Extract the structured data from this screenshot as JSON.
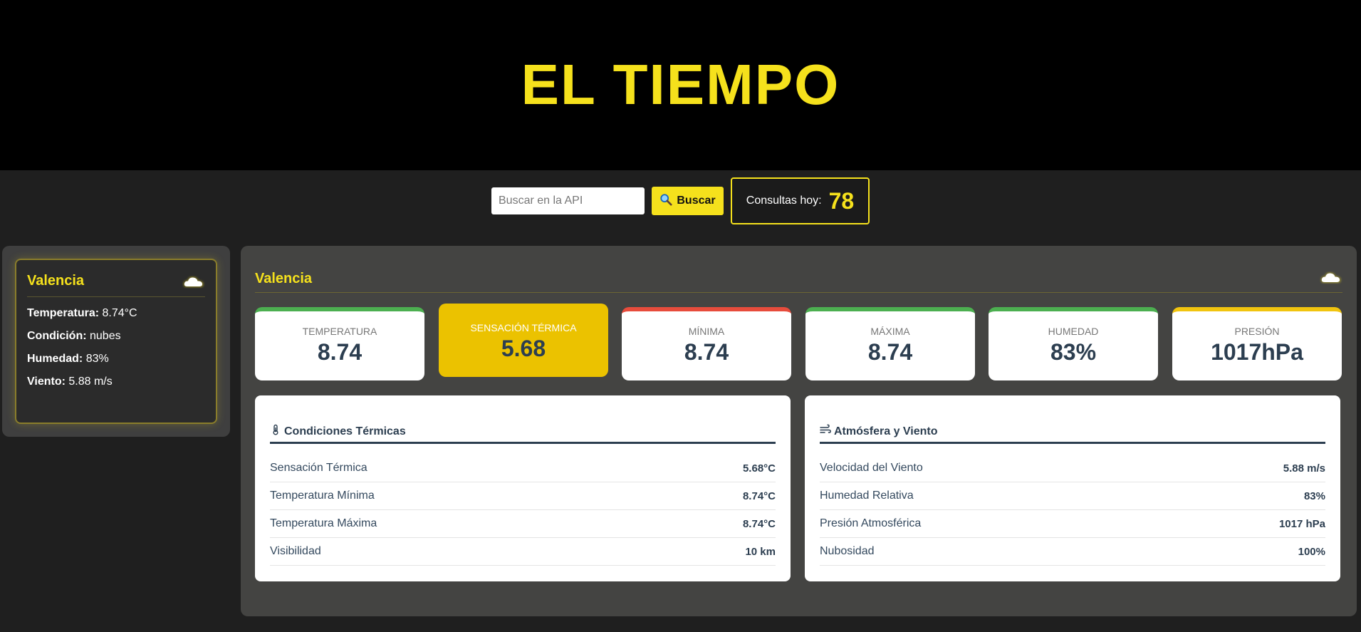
{
  "header": {
    "title": "EL TIEMPO"
  },
  "search": {
    "placeholder": "Buscar en la API",
    "button_label": "Buscar",
    "counter_label": "Consultas hoy:",
    "counter_value": "78"
  },
  "sidebar": {
    "city": "Valencia",
    "icon": "cloud-icon",
    "lines": [
      {
        "key": "Temperatura:",
        "value": "8.74°C"
      },
      {
        "key": "Condición:",
        "value": "nubes"
      },
      {
        "key": "Humedad:",
        "value": "83%"
      },
      {
        "key": "Viento:",
        "value": "5.88 m/s"
      }
    ]
  },
  "main": {
    "city": "Valencia",
    "icon": "cloud-icon",
    "stats": [
      {
        "label": "TEMPERATURA",
        "value": "8.74",
        "accent": "#4caf50"
      },
      {
        "label": "SENSACIÓN TÉRMICA",
        "value": "5.68",
        "accent": "#ebc200"
      },
      {
        "label": "MÍNIMA",
        "value": "8.74",
        "accent": "#e74c3c"
      },
      {
        "label": "MÁXIMA",
        "value": "8.74",
        "accent": "#4caf50"
      },
      {
        "label": "HUMEDAD",
        "value": "83%",
        "accent": "#4caf50"
      },
      {
        "label": "PRESIÓN",
        "value": "1017hPa",
        "accent": "#f1c40f"
      }
    ],
    "thermal": {
      "title": "Condiciones Térmicas",
      "icon": "thermometer-icon",
      "rows": [
        {
          "key": "Sensación Térmica",
          "value": "5.68°C"
        },
        {
          "key": "Temperatura Mínima",
          "value": "8.74°C"
        },
        {
          "key": "Temperatura Máxima",
          "value": "8.74°C"
        },
        {
          "key": "Visibilidad",
          "value": "10 km"
        }
      ]
    },
    "atmosphere": {
      "title": "Atmósfera y Viento",
      "icon": "wind-icon",
      "rows": [
        {
          "key": "Velocidad del Viento",
          "value": "5.88 m/s"
        },
        {
          "key": "Humedad Relativa",
          "value": "83%"
        },
        {
          "key": "Presión Atmosférica",
          "value": "1017 hPa"
        },
        {
          "key": "Nubosidad",
          "value": "100%"
        }
      ]
    }
  },
  "colors": {
    "brand_yellow": "#f5e11c",
    "highlight_yellow": "#ebc200",
    "text_dark": "#2c3e50"
  }
}
